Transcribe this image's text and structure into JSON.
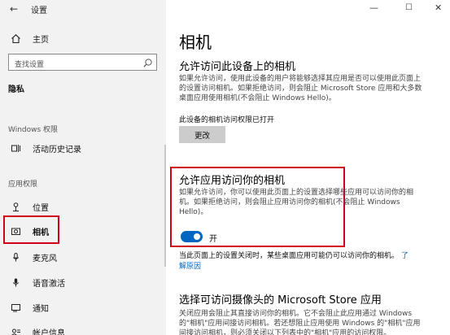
{
  "window": {
    "back_glyph": "←",
    "title": "设置",
    "minimize_glyph": "—",
    "maximize_glyph": "☐",
    "close_glyph": "✕"
  },
  "sidebar": {
    "home_label": "主页",
    "search_placeholder": "查找设置",
    "privacy_heading": "隐私",
    "windows_permissions_label": "Windows 权限",
    "activity_history_label": "活动历史记录",
    "app_permissions_label": "应用权限",
    "items": [
      {
        "label": "位置",
        "icon": "location-icon"
      },
      {
        "label": "相机",
        "icon": "camera-icon",
        "selected": true
      },
      {
        "label": "麦克风",
        "icon": "microphone-icon"
      },
      {
        "label": "语音激活",
        "icon": "voice-activation-icon"
      },
      {
        "label": "通知",
        "icon": "notification-icon"
      },
      {
        "label": "帐户信息",
        "icon": "account-info-icon"
      }
    ]
  },
  "main": {
    "page_title": "相机",
    "section1": {
      "heading": "允许访问此设备上的相机",
      "desc": "如果允许访问，使用此设备的用户将能够选择其应用是否可以使用此页面上的设置访问相机。如果拒绝访问，则会阻止 Microsoft Store 应用和大多数桌面应用使用相机(不会阻止 Windows Hello)。",
      "status_text": "此设备的相机访问权限已打开",
      "change_button": "更改"
    },
    "section2": {
      "heading": "允许应用访问你的相机",
      "desc": "如果允许访问，你可以使用此页面上的设置选择哪些应用可以访问你的相机。如果拒绝访问，则会阻止应用访问你的相机(不会阻止 Windows Hello)。",
      "toggle_on": true,
      "toggle_label": "开",
      "note": "当此页面上的设置关闭时，某些桌面应用可能仍可以访问你的相机。",
      "link_prefix": "了",
      "link_suffix": "解原因"
    },
    "section3": {
      "heading": "选择可访问摄像头的 Microsoft Store 应用",
      "desc": "关闭应用会阻止其直接访问你的相机。它不会阻止此应用通过 Windows 的\"相机\"应用间接访问相机。若还想阻止应用使用 Windows 的\"相机\"应用间接访问相机，则必须关闭以下列表中的\"相机\"应用的访问权限。"
    }
  },
  "colors": {
    "accent": "#0067c0",
    "highlight": "#d0021b",
    "sidebar_bg": "#f2f2f2"
  }
}
